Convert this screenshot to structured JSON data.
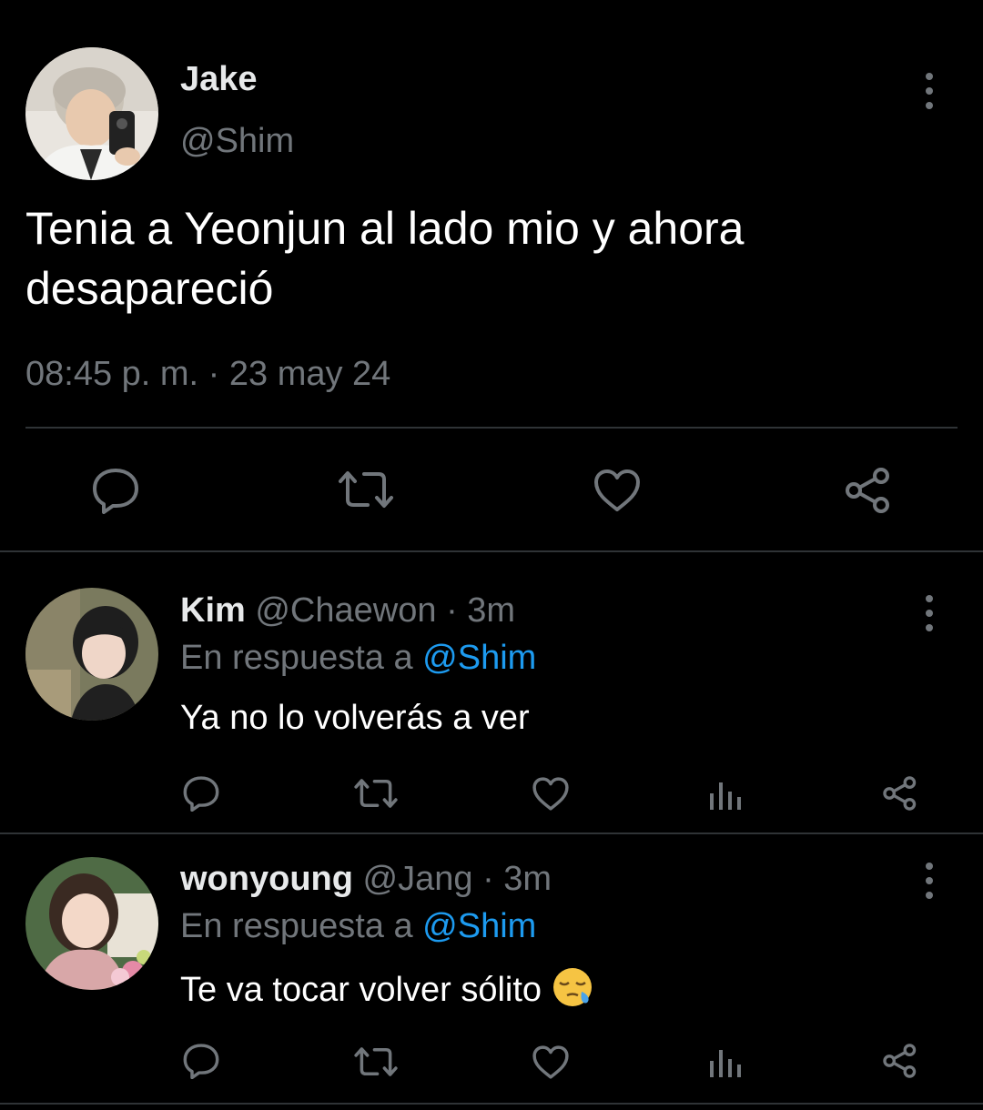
{
  "main_tweet": {
    "author_name": "Jake",
    "author_handle": "@Shim",
    "text_line1": "Tenia a Yeonjun al lado mio y ahora",
    "text_line2": "desapareció",
    "timestamp": "08:45 p. m. · 23 may 24",
    "avatar_icon": "avatar-jake",
    "actions": [
      "reply-icon",
      "retweet-icon",
      "like-icon",
      "share-icon"
    ]
  },
  "replies": [
    {
      "author_name": "Kim",
      "author_handle": "@Chaewon",
      "time": "· 3m",
      "reply_prefix": "En respuesta a",
      "reply_to": "@Shim",
      "text": "Ya no lo volverás a ver",
      "avatar_icon": "avatar-kim",
      "actions": [
        "reply-icon",
        "retweet-icon",
        "like-icon",
        "views-icon",
        "share-icon"
      ]
    },
    {
      "author_name": "wonyoung",
      "author_handle": "@Jang",
      "time": "· 3m",
      "reply_prefix": "En respuesta a",
      "reply_to": "@Shim",
      "text": "Te va tocar volver sólito",
      "emoji": "sleepy-face-emoji",
      "avatar_icon": "avatar-wonyoung",
      "actions": [
        "reply-icon",
        "retweet-icon",
        "like-icon",
        "views-icon",
        "share-icon"
      ]
    }
  ],
  "colors": {
    "background": "#000000",
    "text": "#e7e9ea",
    "muted": "#71767b",
    "link": "#1d9bf0",
    "divider": "#2f3336"
  }
}
